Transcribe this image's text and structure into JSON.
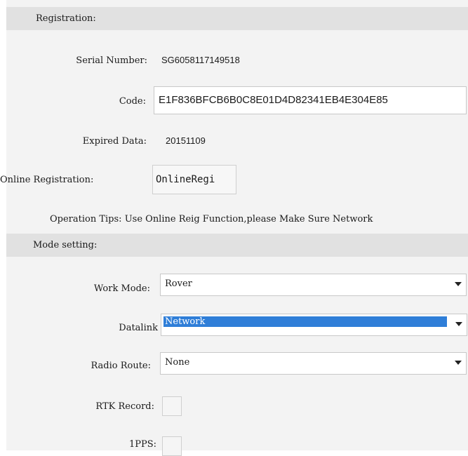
{
  "registration": {
    "header": "Registration:",
    "serial_label": "Serial Number:",
    "serial_value": "SG6058117149518",
    "code_label": "Code:",
    "code_value": "E1F836BFCB6B0C8E01D4D82341EB4E304E85",
    "expired_label": "Expired Data:",
    "expired_value": "20151109",
    "online_label": "Online Registration:",
    "online_button": "OnlineRegi",
    "tips_label": "Operation Tips:",
    "tips_text": "Use Online Reig Function,please Make Sure Network"
  },
  "mode": {
    "header": "Mode setting:",
    "work_mode_label": "Work Mode:",
    "work_mode_value": "Rover",
    "datalink_label": "Datalink",
    "datalink_value": "Network",
    "radio_route_label": "Radio Route:",
    "radio_route_value": "None",
    "rtk_label": "RTK Record:",
    "pps_label": "1PPS:"
  },
  "colors": {
    "selection": "#2f7ed8",
    "header_bg": "#e1e1e1",
    "panel_bg": "#f3f3f3"
  }
}
